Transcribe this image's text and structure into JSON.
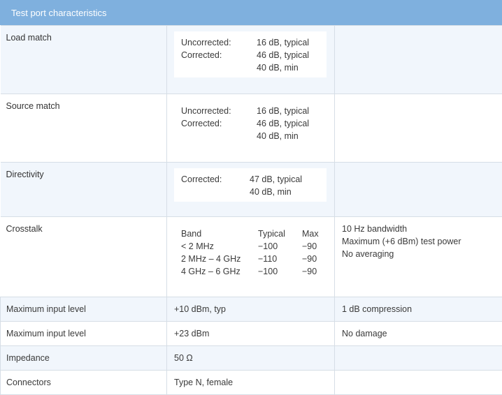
{
  "header": {
    "title": "Test port characteristics"
  },
  "rows": {
    "load_match": {
      "label": "Load match",
      "lines": [
        [
          "Uncorrected:",
          "16 dB, typical"
        ],
        [
          "Corrected:",
          "46 dB, typical"
        ],
        [
          "",
          "40 dB, min"
        ]
      ]
    },
    "source_match": {
      "label": "Source match",
      "lines": [
        [
          "Uncorrected:",
          "16 dB, typical"
        ],
        [
          "Corrected:",
          "46 dB, typical"
        ],
        [
          "",
          "40 dB, min"
        ]
      ]
    },
    "directivity": {
      "label": "Directivity",
      "lines": [
        [
          "Corrected:",
          "47 dB, typical"
        ],
        [
          "",
          "40 dB, min"
        ]
      ]
    },
    "crosstalk": {
      "label": "Crosstalk",
      "headers": [
        "Band",
        "Typical",
        "Max"
      ],
      "bands": [
        [
          "< 2 MHz",
          "−100",
          "−90"
        ],
        [
          "2 MHz – 4 GHz",
          "−110",
          "−90"
        ],
        [
          "4 GHz – 6 GHz",
          "−100",
          "−90"
        ]
      ],
      "notes": [
        "10 Hz bandwidth",
        "Maximum (+6 dBm) test power",
        "No averaging"
      ]
    },
    "max_input_1": {
      "label": "Maximum input level",
      "value": "+10 dBm, typ",
      "note": "1 dB compression"
    },
    "max_input_2": {
      "label": "Maximum input level",
      "value": "+23 dBm",
      "note": "No damage"
    },
    "impedance": {
      "label": "Impedance",
      "value": "50 Ω",
      "note": ""
    },
    "connectors": {
      "label": "Connectors",
      "value": "Type N, female",
      "note": ""
    }
  }
}
